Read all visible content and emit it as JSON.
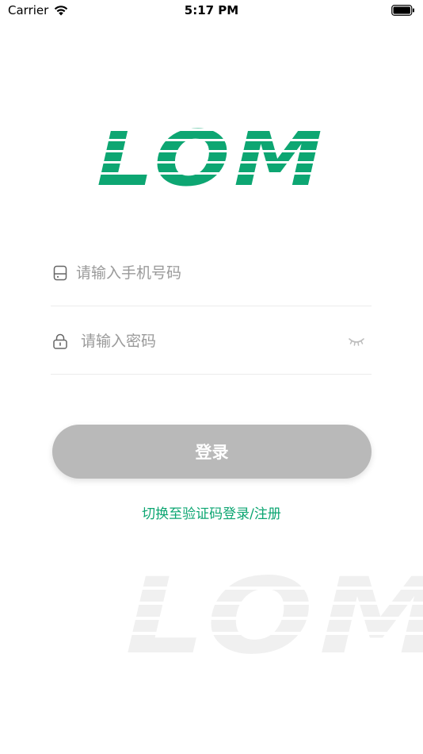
{
  "status_bar": {
    "carrier": "Carrier",
    "time": "5:17 PM"
  },
  "brand": {
    "logo_text": "LOM",
    "color": "#0da672"
  },
  "form": {
    "phone_placeholder": "请输入手机号码",
    "password_placeholder": "请输入密码"
  },
  "actions": {
    "login_label": "登录",
    "switch_label": "切换至验证码登录/注册"
  },
  "icons": {
    "phone": "phone-icon",
    "lock": "lock-icon",
    "eye": "eye-closed-icon",
    "wifi": "wifi-icon",
    "battery": "battery-icon"
  },
  "colors": {
    "accent": "#0da672",
    "button_disabled": "#b9b9b9",
    "watermark": "#f0f0f0"
  }
}
